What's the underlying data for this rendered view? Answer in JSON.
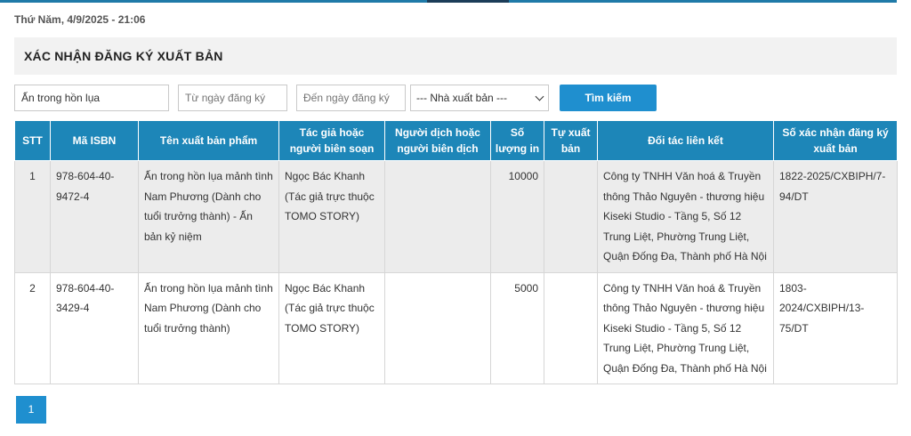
{
  "header": {
    "datetime": "Thứ Năm, 4/9/2025 - 21:06",
    "section_title": "XÁC NHẬN ĐĂNG KÝ XUẤT BẢN"
  },
  "filters": {
    "keyword_value": "Ấn trong hồn lụa",
    "from_date_placeholder": "Từ ngày đăng ký",
    "to_date_placeholder": "Đến ngày đăng ký",
    "publisher_selected": "--- Nhà xuất bản ---",
    "search_label": "Tìm kiếm"
  },
  "table": {
    "columns": [
      "STT",
      "Mã ISBN",
      "Tên xuất bản phẩm",
      "Tác giả hoặc người biên soạn",
      "Người dịch hoặc người biên dịch",
      "Số lượng in",
      "Tự xuất bản",
      "Đối tác liên kết",
      "Số xác nhận đăng ký xuất bản"
    ],
    "rows": [
      {
        "stt": "1",
        "isbn": "978-604-40-9472-4",
        "title": "Ấn trong hồn lụa mảnh tình Nam Phương (Dành cho tuổi trưởng thành) - Ấn bản kỷ niệm",
        "author": "Ngọc Bác Khanh (Tác giả trực thuộc TOMO STORY)",
        "translator": "",
        "quantity": "10000",
        "self_published": "",
        "partner": "Công ty TNHH Văn hoá & Truyền thông Thảo Nguyên - thương hiệu Kiseki Studio - Tầng 5, Số 12 Trung Liệt, Phường Trung Liệt, Quận Đống Đa, Thành phố Hà Nội",
        "confirmation_no": "1822-2025/CXBIPH/7-94/DT"
      },
      {
        "stt": "2",
        "isbn": "978-604-40-3429-4",
        "title": "Ấn trong hồn lụa mảnh tình Nam Phương (Dành cho tuổi trưởng thành)",
        "author": "Ngọc Bác Khanh (Tác giả trực thuộc TOMO STORY)",
        "translator": "",
        "quantity": "5000",
        "self_published": "",
        "partner": "Công ty TNHH Văn hoá & Truyền thông Thảo Nguyên - thương hiệu Kiseki Studio - Tầng 5, Số 12 Trung Liệt, Phường Trung Liệt, Quận Đống Đa, Thành phố Hà Nội",
        "confirmation_no": "1803-2024/CXBIPH/13-75/DT"
      }
    ]
  },
  "pagination": {
    "current_page": "1"
  },
  "colors": {
    "accent": "#1f8fcf",
    "header_bg": "#1d86b8",
    "top_bar": "#1f7aa8"
  }
}
